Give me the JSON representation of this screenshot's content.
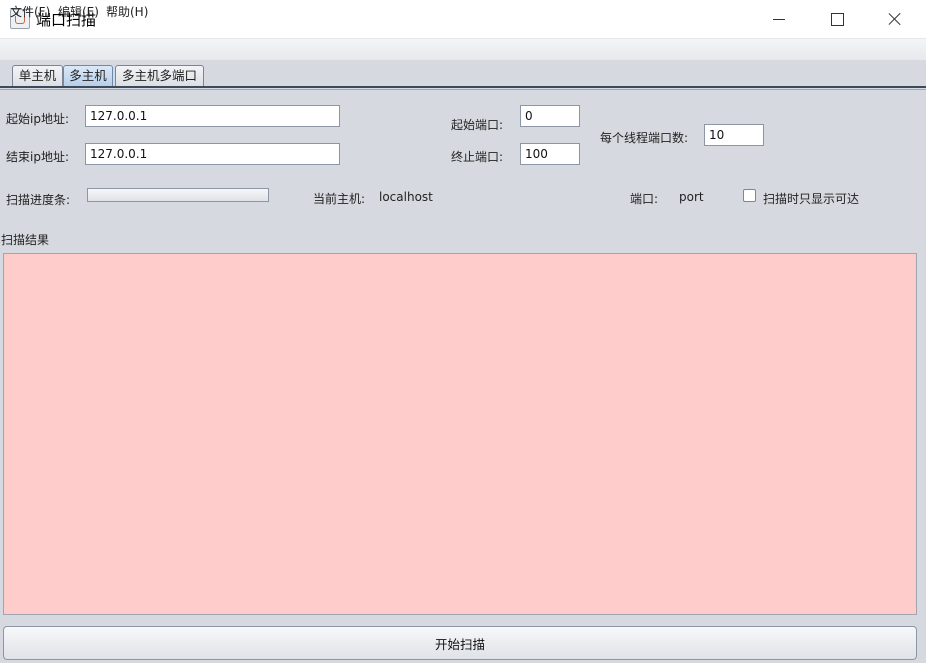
{
  "window": {
    "title": "端口扫描"
  },
  "menu": {
    "file": "文件(F)",
    "edit": "编辑(E)",
    "help": "帮助(H)"
  },
  "tabs": {
    "single_host": "单主机",
    "multi_host": "多主机",
    "multi_host_multi_port": "多主机多端口",
    "selected": "多主机"
  },
  "form": {
    "start_ip_label": "起始ip地址:",
    "start_ip_value": "127.0.0.1",
    "end_ip_label": "结束ip地址:",
    "end_ip_value": "127.0.0.1",
    "start_port_label": "起始端口:",
    "start_port_value": "0",
    "end_port_label": "终止端口:",
    "end_port_value": "100",
    "ports_per_thread_label": "每个线程端口数:",
    "ports_per_thread_value": "10"
  },
  "status": {
    "progress_label": "扫描进度条:",
    "progress_fraction": 0,
    "current_host_label": "当前主机:",
    "current_host_value": "localhost",
    "port_label": "端口:",
    "port_value": "port",
    "show_reachable_label": "扫描时只显示可达",
    "show_reachable_checked": false
  },
  "results": {
    "label": "扫描结果",
    "content": "",
    "background": "#ffcccc"
  },
  "actions": {
    "start_scan": "开始扫描"
  }
}
